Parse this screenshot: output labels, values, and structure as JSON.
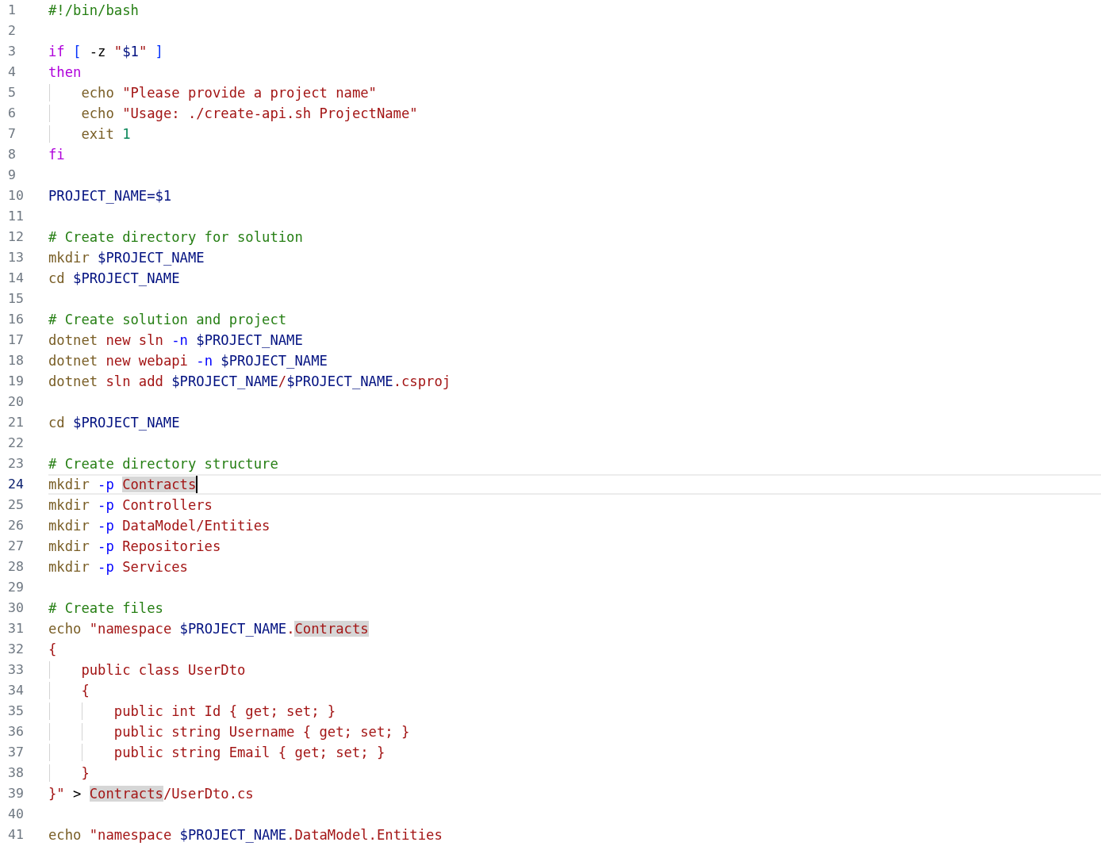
{
  "editor": {
    "lines": [
      {
        "number": "1",
        "current": false,
        "tokens": [
          {
            "kind": "comment",
            "text": "#!/bin/bash"
          }
        ]
      },
      {
        "number": "2",
        "current": false
      },
      {
        "number": "3",
        "current": false,
        "tokens": [
          {
            "kind": "keyword",
            "text": "if "
          },
          {
            "kind": "bracket",
            "text": "["
          },
          {
            "kind": "plain",
            "text": " -z "
          },
          {
            "kind": "string",
            "text": "\""
          },
          {
            "kind": "variable",
            "text": "$1"
          },
          {
            "kind": "string",
            "text": "\" "
          },
          {
            "kind": "bracket",
            "text": "]"
          }
        ]
      },
      {
        "number": "4",
        "current": false,
        "tokens": [
          {
            "kind": "keyword",
            "text": "then"
          }
        ]
      },
      {
        "number": "5",
        "current": false,
        "tokens": [
          {
            "kind": "command",
            "text": "    echo"
          },
          {
            "kind": "string",
            "text": " \"Please provide a project name\""
          }
        ]
      },
      {
        "number": "6",
        "current": false,
        "tokens": [
          {
            "kind": "command",
            "text": "    echo"
          },
          {
            "kind": "string",
            "text": " \"Usage: ./create-api.sh ProjectName\""
          }
        ]
      },
      {
        "number": "7",
        "current": false,
        "tokens": [
          {
            "kind": "command",
            "text": "    exit "
          },
          {
            "kind": "number",
            "text": "1"
          }
        ]
      },
      {
        "number": "8",
        "current": false,
        "tokens": [
          {
            "kind": "keyword",
            "text": "fi"
          }
        ]
      },
      {
        "number": "9",
        "current": false
      },
      {
        "number": "10",
        "current": false,
        "tokens": [
          {
            "kind": "variable",
            "text": "PROJECT_NAME=$1"
          }
        ]
      },
      {
        "number": "11",
        "current": false
      },
      {
        "number": "12",
        "current": false,
        "tokens": [
          {
            "kind": "comment",
            "text": "# Create directory for solution"
          }
        ]
      },
      {
        "number": "13",
        "current": false,
        "tokens": [
          {
            "kind": "command",
            "text": "mkdir "
          },
          {
            "kind": "variable",
            "text": "$PROJECT_NAME"
          }
        ]
      },
      {
        "number": "14",
        "current": false,
        "tokens": [
          {
            "kind": "command",
            "text": "cd "
          },
          {
            "kind": "variable",
            "text": "$PROJECT_NAME"
          }
        ]
      },
      {
        "number": "15",
        "current": false
      },
      {
        "number": "16",
        "current": false,
        "tokens": [
          {
            "kind": "comment",
            "text": "# Create solution and project"
          }
        ]
      },
      {
        "number": "17",
        "current": false,
        "tokens": [
          {
            "kind": "command",
            "text": "dotnet"
          },
          {
            "kind": "string",
            "text": " new sln "
          },
          {
            "kind": "flag",
            "text": "-n "
          },
          {
            "kind": "variable",
            "text": "$PROJECT_NAME"
          }
        ]
      },
      {
        "number": "18",
        "current": false,
        "tokens": [
          {
            "kind": "command",
            "text": "dotnet"
          },
          {
            "kind": "string",
            "text": " new webapi "
          },
          {
            "kind": "flag",
            "text": "-n "
          },
          {
            "kind": "variable",
            "text": "$PROJECT_NAME"
          }
        ]
      },
      {
        "number": "19",
        "current": false,
        "tokens": [
          {
            "kind": "command",
            "text": "dotnet"
          },
          {
            "kind": "string",
            "text": " sln add "
          },
          {
            "kind": "variable",
            "text": "$PROJECT_NAME"
          },
          {
            "kind": "string",
            "text": "/"
          },
          {
            "kind": "variable",
            "text": "$PROJECT_NAME"
          },
          {
            "kind": "string",
            "text": ".csproj"
          }
        ]
      },
      {
        "number": "20",
        "current": false
      },
      {
        "number": "21",
        "current": false,
        "tokens": [
          {
            "kind": "command",
            "text": "cd "
          },
          {
            "kind": "variable",
            "text": "$PROJECT_NAME"
          }
        ]
      },
      {
        "number": "22",
        "current": false
      },
      {
        "number": "23",
        "current": false,
        "tokens": [
          {
            "kind": "comment",
            "text": "# Create directory structure"
          }
        ]
      },
      {
        "number": "24",
        "current": true,
        "tokens": [
          {
            "kind": "command",
            "text": "mkdir "
          },
          {
            "kind": "flag",
            "text": "-p "
          },
          {
            "kind": "match",
            "text": "Contracts"
          }
        ]
      },
      {
        "number": "25",
        "current": false,
        "tokens": [
          {
            "kind": "command",
            "text": "mkdir "
          },
          {
            "kind": "flag",
            "text": "-p"
          },
          {
            "kind": "string",
            "text": " Controllers"
          }
        ]
      },
      {
        "number": "26",
        "current": false,
        "tokens": [
          {
            "kind": "command",
            "text": "mkdir "
          },
          {
            "kind": "flag",
            "text": "-p"
          },
          {
            "kind": "string",
            "text": " DataModel/Entities"
          }
        ]
      },
      {
        "number": "27",
        "current": false,
        "tokens": [
          {
            "kind": "command",
            "text": "mkdir "
          },
          {
            "kind": "flag",
            "text": "-p"
          },
          {
            "kind": "string",
            "text": " Repositories"
          }
        ]
      },
      {
        "number": "28",
        "current": false,
        "tokens": [
          {
            "kind": "command",
            "text": "mkdir "
          },
          {
            "kind": "flag",
            "text": "-p"
          },
          {
            "kind": "string",
            "text": " Services"
          }
        ]
      },
      {
        "number": "29",
        "current": false
      },
      {
        "number": "30",
        "current": false,
        "tokens": [
          {
            "kind": "comment",
            "text": "# Create files"
          }
        ]
      },
      {
        "number": "31",
        "current": false,
        "tokens": [
          {
            "kind": "command",
            "text": "echo"
          },
          {
            "kind": "string",
            "text": " \"namespace "
          },
          {
            "kind": "variable",
            "text": "$PROJECT_NAME"
          },
          {
            "kind": "string",
            "text": "."
          },
          {
            "kind": "match",
            "text": "Contracts"
          }
        ]
      },
      {
        "number": "32",
        "current": false,
        "tokens": [
          {
            "kind": "string",
            "text": "{"
          }
        ]
      },
      {
        "number": "33",
        "current": false,
        "tokens": [
          {
            "kind": "string",
            "text": "    public class UserDto"
          }
        ]
      },
      {
        "number": "34",
        "current": false,
        "tokens": [
          {
            "kind": "string",
            "text": "    {"
          }
        ]
      },
      {
        "number": "35",
        "current": false,
        "tokens": [
          {
            "kind": "string",
            "text": "        public int Id { get; set; }"
          }
        ]
      },
      {
        "number": "36",
        "current": false,
        "tokens": [
          {
            "kind": "string",
            "text": "        public string Username { get; set; }"
          }
        ]
      },
      {
        "number": "37",
        "current": false,
        "tokens": [
          {
            "kind": "string",
            "text": "        public string Email { get; set; }"
          }
        ]
      },
      {
        "number": "38",
        "current": false,
        "tokens": [
          {
            "kind": "string",
            "text": "    }"
          }
        ]
      },
      {
        "number": "39",
        "current": false,
        "tokens": [
          {
            "kind": "string",
            "text": "}\""
          },
          {
            "kind": "plain",
            "text": " > "
          },
          {
            "kind": "match",
            "text": "Contracts"
          },
          {
            "kind": "string",
            "text": "/UserDto.cs"
          }
        ]
      },
      {
        "number": "40",
        "current": false
      },
      {
        "number": "41",
        "current": false,
        "tokens": [
          {
            "kind": "command",
            "text": "echo"
          },
          {
            "kind": "string",
            "text": " \"namespace "
          },
          {
            "kind": "variable",
            "text": "$PROJECT_NAME"
          },
          {
            "kind": "string",
            "text": ".DataModel.Entities"
          }
        ]
      }
    ]
  }
}
